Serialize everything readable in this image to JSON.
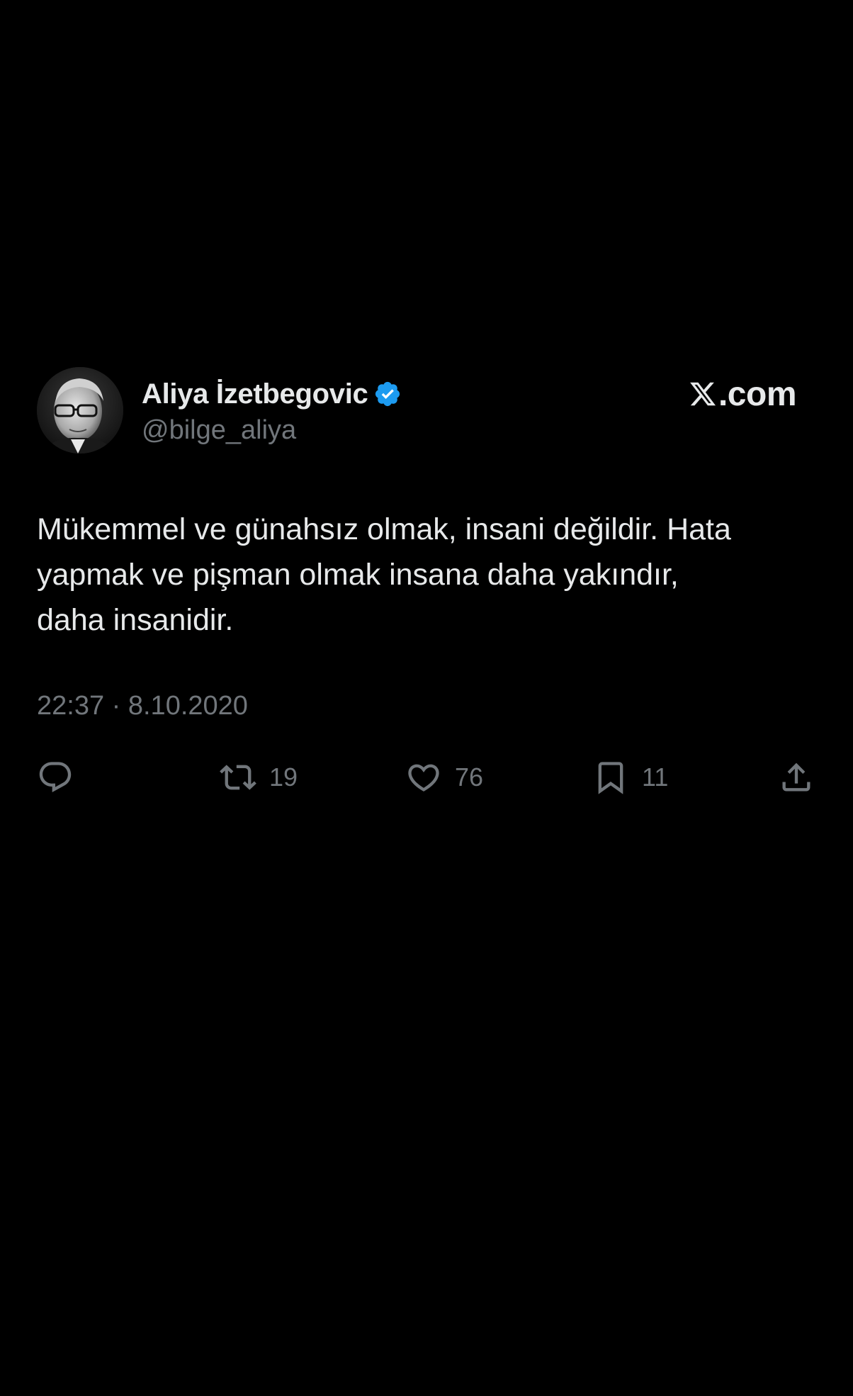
{
  "author": {
    "display_name": "Aliya İzetbegovic",
    "handle": "@bilge_aliya",
    "verified": true
  },
  "site": {
    "label": ".com",
    "icon": "x-logo-icon"
  },
  "tweet": {
    "text_lines": [
      "Mükemmel ve günahsız olmak, insani değildir. Hata",
      "yapmak ve pişman olmak insana daha yakındır,",
      "daha insanidir."
    ],
    "timestamp": "22:37 · 8.10.2020"
  },
  "actions": {
    "reply": {
      "icon": "reply-icon"
    },
    "retweet": {
      "icon": "retweet-icon",
      "count": "19"
    },
    "like": {
      "icon": "heart-icon",
      "count": "76"
    },
    "bookmark": {
      "icon": "bookmark-icon",
      "count": "11"
    },
    "share": {
      "icon": "share-icon"
    }
  },
  "colors": {
    "background": "#000000",
    "text_primary": "#e7e9ea",
    "text_secondary": "#71767b",
    "verified_blue": "#1d9bf0"
  }
}
